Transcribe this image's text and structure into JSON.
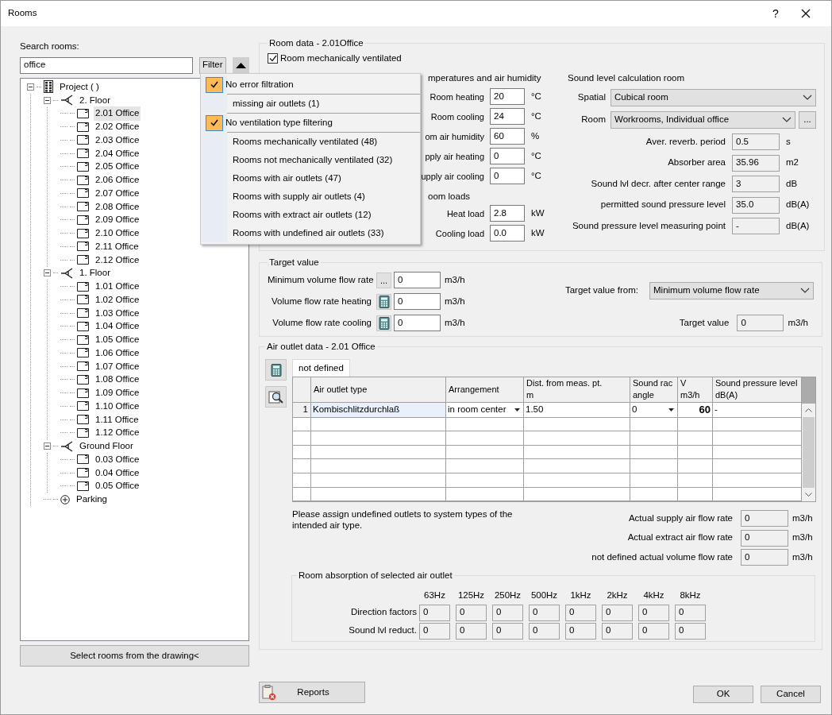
{
  "window": {
    "title": "Rooms",
    "help": "?"
  },
  "search": {
    "label": "Search rooms:",
    "value": "office",
    "filter_button": "Filter"
  },
  "filter_menu": {
    "sections": [
      {
        "items": [
          {
            "label": "No error filtration",
            "checked": true
          }
        ]
      },
      {
        "items": [
          {
            "label": "missing air outlets (1)",
            "checked": false
          }
        ]
      },
      {
        "items": [
          {
            "label": "No ventilation type filtering",
            "checked": true
          }
        ]
      },
      {
        "items": [
          {
            "label": "Rooms mechanically ventilated (48)",
            "checked": false
          },
          {
            "label": "Rooms not mechanically ventilated (32)",
            "checked": false
          },
          {
            "label": "Rooms with air outlets (47)",
            "checked": false
          },
          {
            "label": "Rooms with supply air outlets (4)",
            "checked": false
          },
          {
            "label": "Rooms with extract air outlets (12)",
            "checked": false
          },
          {
            "label": "Rooms with undefined air outlets (33)",
            "checked": false
          }
        ]
      }
    ]
  },
  "tree": [
    {
      "label": "Project ( )",
      "kind": "project",
      "expanded": true,
      "selected": false,
      "children": [
        {
          "label": "2. Floor",
          "kind": "floor",
          "expanded": true,
          "selected": false,
          "children": [
            {
              "label": "2.01 Office",
              "kind": "room",
              "selected": true
            },
            {
              "label": "2.02 Office",
              "kind": "room",
              "selected": false
            },
            {
              "label": "2.03 Office",
              "kind": "room",
              "selected": false
            },
            {
              "label": "2.04 Office",
              "kind": "room",
              "selected": false
            },
            {
              "label": "2.05 Office",
              "kind": "room",
              "selected": false
            },
            {
              "label": "2.06 Office",
              "kind": "room",
              "selected": false
            },
            {
              "label": "2.07 Office",
              "kind": "room",
              "selected": false
            },
            {
              "label": "2.08 Office",
              "kind": "room",
              "selected": false
            },
            {
              "label": "2.09 Office",
              "kind": "room",
              "selected": false
            },
            {
              "label": "2.10 Office",
              "kind": "room",
              "selected": false
            },
            {
              "label": "2.11 Office",
              "kind": "room",
              "selected": false
            },
            {
              "label": "2.12 Office",
              "kind": "room",
              "selected": false
            }
          ]
        },
        {
          "label": "1. Floor",
          "kind": "floor",
          "expanded": true,
          "selected": false,
          "children": [
            {
              "label": "1.01 Office",
              "kind": "room",
              "selected": false
            },
            {
              "label": "1.02 Office",
              "kind": "room",
              "selected": false
            },
            {
              "label": "1.03 Office",
              "kind": "room",
              "selected": false
            },
            {
              "label": "1.04 Office",
              "kind": "room",
              "selected": false
            },
            {
              "label": "1.05 Office",
              "kind": "room",
              "selected": false
            },
            {
              "label": "1.06 Office",
              "kind": "room",
              "selected": false
            },
            {
              "label": "1.07 Office",
              "kind": "room",
              "selected": false
            },
            {
              "label": "1.08 Office",
              "kind": "room",
              "selected": false
            },
            {
              "label": "1.09 Office",
              "kind": "room",
              "selected": false
            },
            {
              "label": "1.10 Office",
              "kind": "room",
              "selected": false
            },
            {
              "label": "1.11 Office",
              "kind": "room",
              "selected": false
            },
            {
              "label": "1.12 Office",
              "kind": "room",
              "selected": false
            }
          ]
        },
        {
          "label": "Ground Floor",
          "kind": "floor",
          "expanded": true,
          "selected": false,
          "children": [
            {
              "label": "0.03 Office",
              "kind": "room",
              "selected": false
            },
            {
              "label": "0.04 Office",
              "kind": "room",
              "selected": false
            },
            {
              "label": "0.05 Office",
              "kind": "room",
              "selected": false
            }
          ]
        },
        {
          "label": "Parking",
          "kind": "area",
          "selected": false
        }
      ]
    }
  ],
  "select_drawing_button": "Select rooms from the drawing<",
  "room_data": {
    "title": "Room data - 2.01Office",
    "mechanically_ventilated": {
      "label": "Room mechanically ventilated",
      "checked": true
    },
    "temperatures": {
      "heading": "mperatures and air humidity",
      "fields": [
        {
          "label": "Room heating",
          "value": "20",
          "unit": "°C"
        },
        {
          "label": "Room cooling",
          "value": "24",
          "unit": "°C"
        },
        {
          "label": "om air humidity",
          "value": "60",
          "unit": "%"
        },
        {
          "label": "pply air heating",
          "value": "0",
          "unit": "°C"
        },
        {
          "label": "upply air cooling",
          "value": "0",
          "unit": "°C"
        }
      ]
    },
    "loads": {
      "heading": "oom loads",
      "fields": [
        {
          "label": "Heat load",
          "value": "2.8",
          "unit": "kW"
        },
        {
          "label": "Cooling load",
          "value": "0.0",
          "unit": "kW"
        }
      ]
    },
    "sound": {
      "heading": "Sound level calculation room",
      "spatial": {
        "label": "Spatial",
        "value": "Cubical room"
      },
      "room": {
        "label": "Room",
        "value": "Workrooms, Individual office",
        "button": "..."
      },
      "fields": [
        {
          "label": "Aver. reverb. period",
          "value": "0.5",
          "unit": "s"
        },
        {
          "label": "Absorber area",
          "value": "35.96",
          "unit": "m2"
        },
        {
          "label": "Sound lvl decr. after center range",
          "value": "3",
          "unit": "dB"
        },
        {
          "label": "permitted sound pressure level",
          "value": "35.0",
          "unit": "dB(A)"
        },
        {
          "label": "Sound pressure level measuring point",
          "value": "-",
          "unit": "dB(A)"
        }
      ]
    }
  },
  "target": {
    "title": "Target value",
    "rows": [
      {
        "label": "Minimum volume flow rate",
        "kind": "more",
        "button": "...",
        "value": "0",
        "unit": "m3/h"
      },
      {
        "label": "Volume flow rate heating",
        "kind": "calculator",
        "value": "0",
        "unit": "m3/h"
      },
      {
        "label": "Volume flow rate cooling",
        "kind": "calculator",
        "value": "0",
        "unit": "m3/h"
      }
    ],
    "from": {
      "label": "Target value from:",
      "value": "Minimum volume flow rate"
    },
    "result": {
      "label": "Target value",
      "value": "0",
      "unit": "m3/h"
    }
  },
  "air_outlets": {
    "title": "Air outlet data - 2.01 Office",
    "tabs": [
      {
        "label": "not defined",
        "selected": true
      }
    ],
    "columns": [
      {
        "kind": "index"
      },
      {
        "kind": "text",
        "lines": [
          "Air outlet type"
        ]
      },
      {
        "kind": "dropdown",
        "lines": [
          "Arrangement"
        ]
      },
      {
        "kind": "text",
        "lines": [
          "Dist. from meas. pt.",
          "m"
        ]
      },
      {
        "kind": "dropdown",
        "lines": [
          "Sound rac",
          "angle"
        ]
      },
      {
        "kind": "number",
        "lines": [
          "V",
          "m3/h"
        ]
      },
      {
        "kind": "text",
        "lines": [
          "Sound pressure level",
          "dB(A)"
        ]
      }
    ],
    "rows": [
      {
        "cells": [
          "1",
          "Kombischlitzdurchlaß",
          "in room center",
          "1.50",
          "0",
          "60",
          "-"
        ],
        "selected": true
      }
    ],
    "note": "Please assign undefined outlets to system types of the intended air type.",
    "flows": [
      {
        "label": "Actual supply air flow rate",
        "value": "0",
        "unit": "m3/h"
      },
      {
        "label": "Actual extract air flow rate",
        "value": "0",
        "unit": "m3/h"
      },
      {
        "label": "not defined actual volume flow rate",
        "value": "0",
        "unit": "m3/h"
      }
    ],
    "absorption": {
      "title": "Room absorption of selected air outlet",
      "frequencies": [
        "63Hz",
        "125Hz",
        "250Hz",
        "500Hz",
        "1kHz",
        "2kHz",
        "4kHz",
        "8kHz"
      ],
      "rows": [
        {
          "label": "Direction factors",
          "values": [
            "0",
            "0",
            "0",
            "0",
            "0",
            "0",
            "0",
            "0"
          ]
        },
        {
          "label": "Sound lvl reduct.",
          "values": [
            "0",
            "0",
            "0",
            "0",
            "0",
            "0",
            "0",
            "0"
          ]
        }
      ]
    }
  },
  "buttons": {
    "reports": "Reports",
    "ok": "OK",
    "cancel": "Cancel"
  }
}
